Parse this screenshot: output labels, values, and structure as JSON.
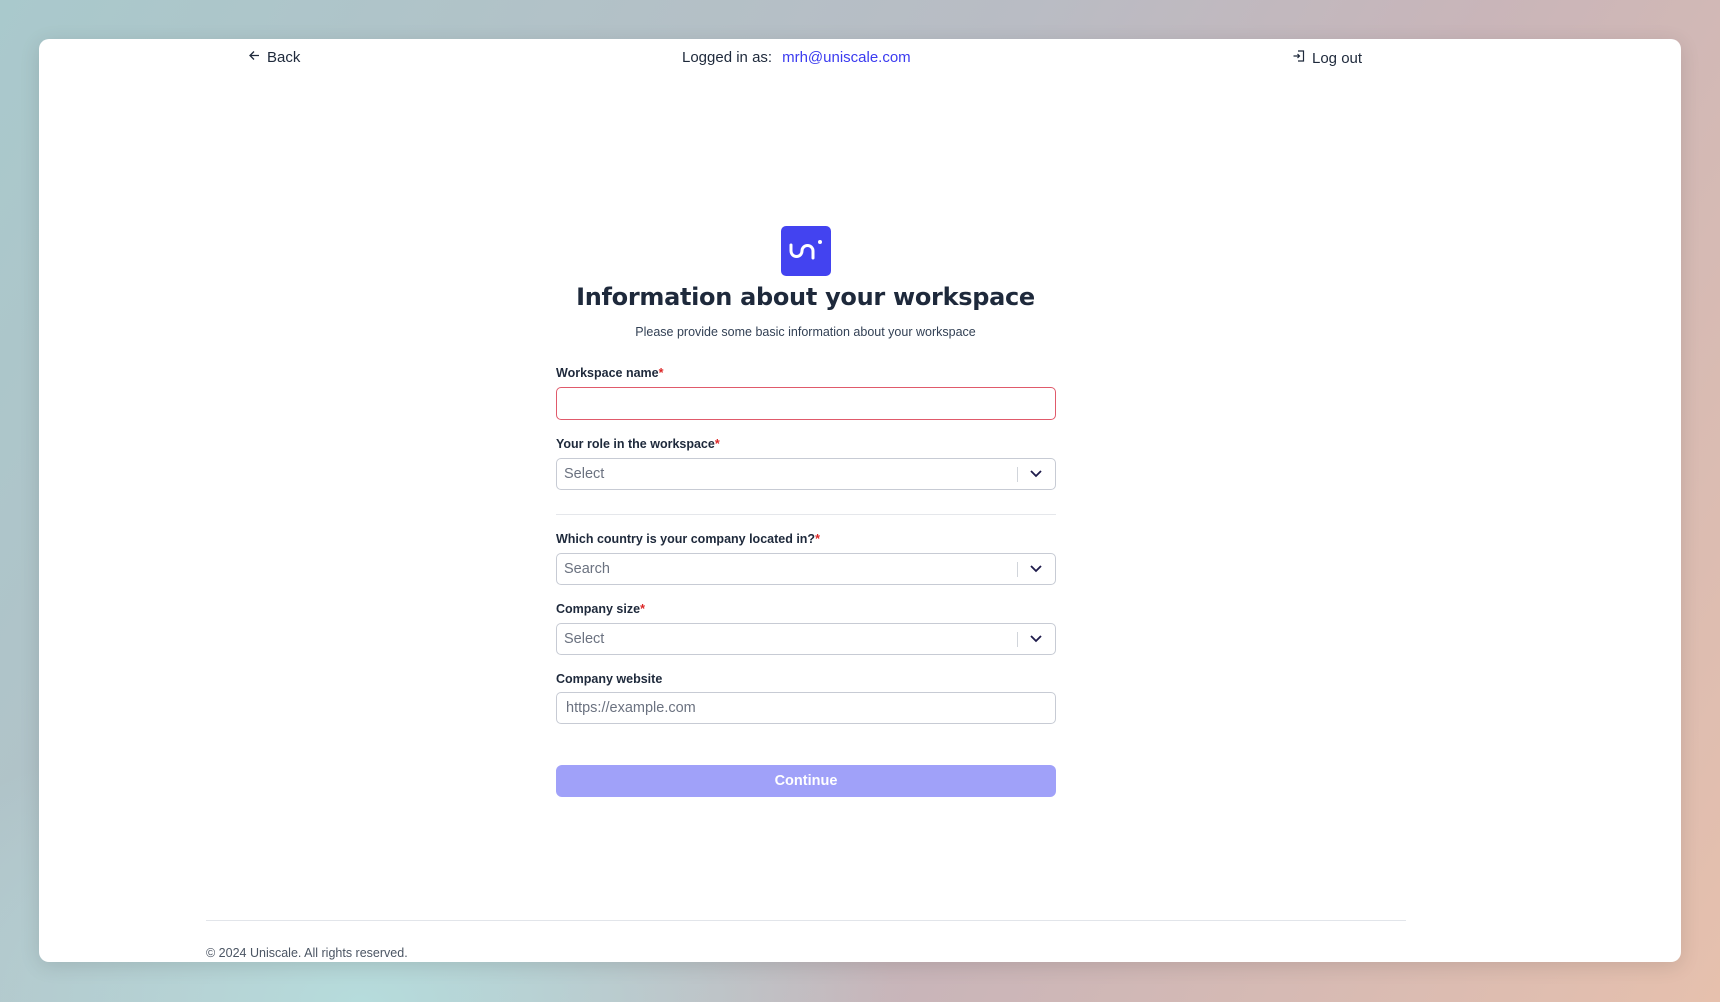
{
  "header": {
    "back_label": "Back",
    "logged_in_label": "Logged in as:",
    "email": "mrh@uniscale.com",
    "logout_label": "Log out"
  },
  "brand": {
    "logo_text": "uni",
    "color": "#4343f0"
  },
  "page": {
    "title": "Information about your workspace",
    "subtitle": "Please provide some basic information about your workspace"
  },
  "form": {
    "workspace_name": {
      "label": "Workspace name",
      "required": "*",
      "value": ""
    },
    "role": {
      "label": "Your role in the workspace",
      "required": "*",
      "placeholder": "Select"
    },
    "country": {
      "label": "Which country is your company located in?",
      "required": "*",
      "placeholder": "Search"
    },
    "size": {
      "label": "Company size",
      "required": "*",
      "placeholder": "Select"
    },
    "website": {
      "label": "Company website",
      "placeholder": "https://example.com"
    },
    "continue_label": "Continue"
  },
  "footer": {
    "copyright": "© 2024 Uniscale. All rights reserved."
  }
}
